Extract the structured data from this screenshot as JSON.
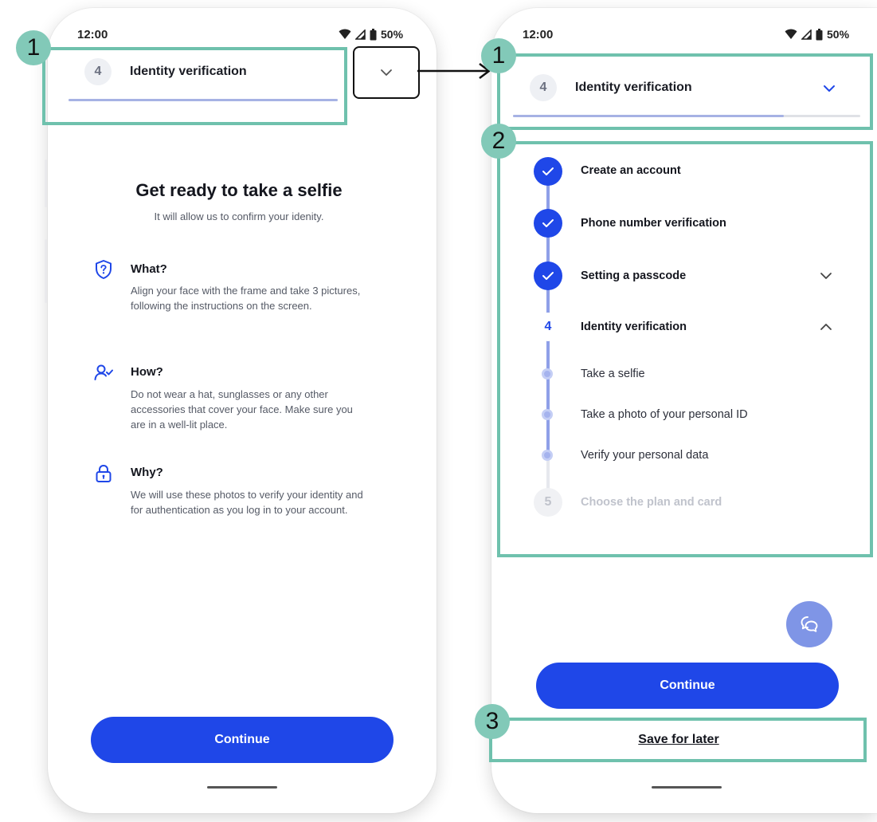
{
  "left_screen": {
    "status": {
      "time": "12:00",
      "battery": "50%"
    },
    "header": {
      "step_number": "4",
      "step_title": "Identity verification"
    },
    "heading": "Get ready to take a selfie",
    "subheading": "It will allow us to confirm your idenity.",
    "sections": [
      {
        "icon": "shield-question-icon",
        "title": "What?",
        "text": "Align your face with the frame and take 3 pictures, following the instructions on the screen."
      },
      {
        "icon": "user-check-icon",
        "title": "How?",
        "text": "Do not wear a hat, sunglasses or any other accessories that cover your face. Make sure you are in a well-lit place."
      },
      {
        "icon": "lock-icon",
        "title": "Why?",
        "text": "We will use these photos to verify your identity and for authentication as you log in to your account."
      }
    ],
    "continue_label": "Continue"
  },
  "right_screen": {
    "status": {
      "time": "12:00",
      "battery": "50%"
    },
    "header": {
      "step_number": "4",
      "step_title": "Identity verification"
    },
    "steps": [
      {
        "label": "Create an account",
        "state": "done"
      },
      {
        "label": "Phone number verification",
        "state": "done"
      },
      {
        "label": "Setting a passcode",
        "state": "done"
      },
      {
        "number": "4",
        "label": "Identity verification",
        "state": "current"
      },
      {
        "number": "5",
        "label": "Choose the plan and card",
        "state": "upcoming"
      }
    ],
    "substeps": [
      "Take a selfie",
      "Take a photo of your personal ID",
      "Verify your personal data"
    ],
    "continue_label": "Continue",
    "save_label": "Save for later"
  },
  "annotations": [
    "1",
    "1",
    "2",
    "3"
  ],
  "colors": {
    "primary": "#1f47e8",
    "annotation": "#6fc1ad",
    "progress": "#a6b2e4"
  }
}
